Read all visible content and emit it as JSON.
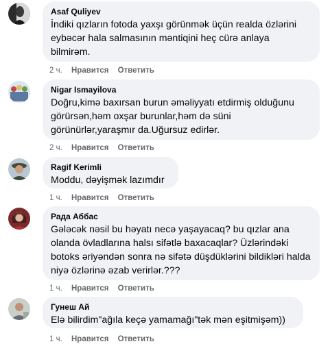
{
  "comments": [
    {
      "author": "Asaf Quliyev",
      "text": "İndiki qızların fotoda yaxşı görünmək üçün realda özlərini eybəcər hala salmasının məntiqini heç cürə anlaya bilmirəm.",
      "time": "2 ч.",
      "like": "Нравится",
      "reply": "Ответить"
    },
    {
      "author": "Nigar Ismayilova",
      "text": "Doğru,kimə baxırsan burun əməliyyatı etdirmiş olduğunu görürsən,həm oxşar burunlar,həm də süni görünürlər,yaraşmır da.Uğursuz edirlər.",
      "time": "2 ч.",
      "like": "Нравится",
      "reply": "Ответить"
    },
    {
      "author": "Ragif Kerimli",
      "text": "Moddu, dəyişmək lazımdır",
      "time": "1 ч.",
      "like": "Нравится",
      "reply": "Ответить"
    },
    {
      "author": "Рада Аббас",
      "text": "Gələcək nəsil bu həyatı necə yaşayacaq? bu qızlar ana olanda övladlarına halsı sifətlə baxacaqlar? Üzlərindəki botoks əriyəndən sonra nə sifətə düşdüklərini bildikləri halda niyə özlərinə əzab verirlər.???",
      "time": "1 ч.",
      "like": "Нравится",
      "reply": "Ответить"
    },
    {
      "author": "Гунеш Ай",
      "text": "Elə bilirdim\"ağıla keçə yamamağı\"tək mən eşitmişəm))",
      "time": "1 ч.",
      "like": "Нравится",
      "reply": "Ответить"
    }
  ]
}
